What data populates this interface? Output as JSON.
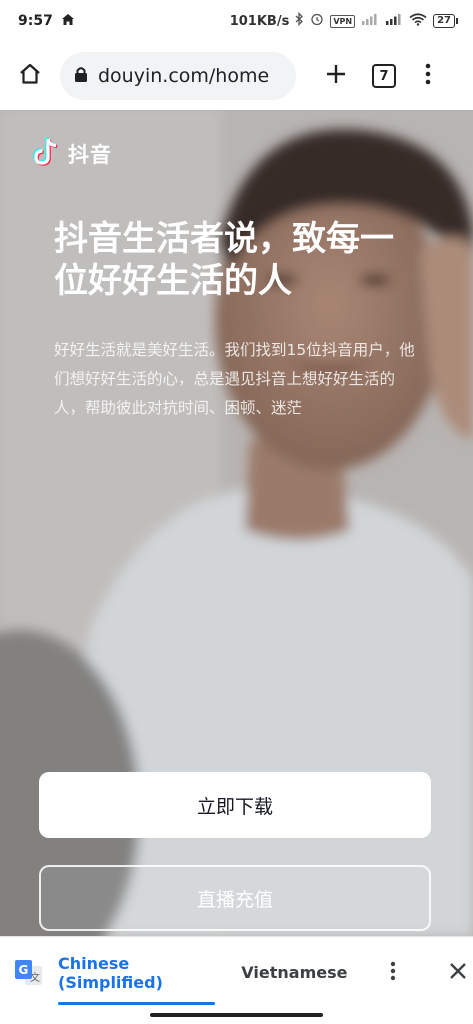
{
  "status_bar": {
    "time": "9:57",
    "network_speed": "101KB/s",
    "vpn_label": "VPN",
    "battery": "27",
    "icons": [
      "home-icon",
      "bluetooth-icon",
      "alarm-icon",
      "signal-icon",
      "wifi-icon",
      "battery-icon"
    ]
  },
  "browser": {
    "url": "douyin.com/home",
    "tab_count": "7",
    "icons": [
      "home-icon",
      "lock-icon",
      "new-tab-icon",
      "tab-switcher-icon",
      "more-vert-icon"
    ]
  },
  "hero": {
    "logo_text": "抖音",
    "headline": "抖音生活者说，致每一位好好生活的人",
    "subtext": "好好生活就是美好生活。我们找到15位抖音用户，他们想好好生活的心，总是遇见抖音上想好好生活的人，帮助彼此对抗时间、困顿、迷茫",
    "primary_button": "立即下载",
    "secondary_button": "直播充值"
  },
  "translate_bar": {
    "active_language": "Chinese (Simplified)",
    "other_language": "Vietnamese",
    "icons": [
      "google-translate-icon",
      "more-vert-icon",
      "close-icon"
    ]
  },
  "colors": {
    "accent_blue": "#1a73e8",
    "button_bg": "#ffffff",
    "text_dark": "#161823"
  }
}
